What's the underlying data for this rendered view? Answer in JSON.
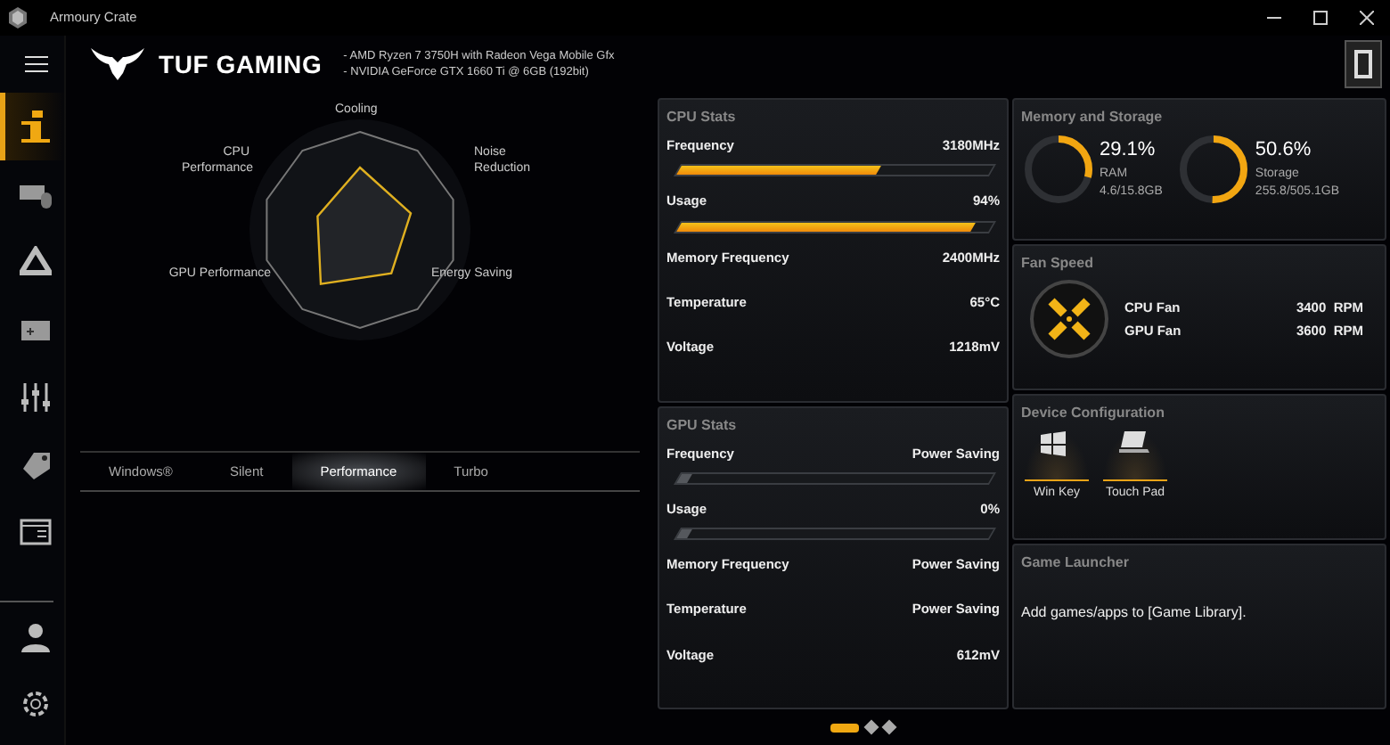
{
  "window": {
    "title": "Armoury Crate"
  },
  "header": {
    "brand": "TUF GAMING",
    "specs": [
      "-  AMD Ryzen 7 3750H with Radeon Vega Mobile Gfx",
      "-  NVIDIA GeForce GTX 1660 Ti @ 6GB (192bit)"
    ]
  },
  "sidebar": {
    "items": [
      {
        "kind": "info",
        "selected": true
      },
      {
        "kind": "keyboard",
        "selected": false
      },
      {
        "kind": "triangle",
        "selected": false
      },
      {
        "kind": "gamepad",
        "selected": false
      },
      {
        "kind": "sliders",
        "selected": false
      },
      {
        "kind": "tag",
        "selected": false
      },
      {
        "kind": "screen",
        "selected": false
      }
    ],
    "bottom": [
      {
        "kind": "user",
        "selected": false
      },
      {
        "kind": "settings",
        "selected": false
      }
    ]
  },
  "radar": {
    "axes": [
      "Cooling",
      "CPU Performance",
      "Noise Reduction",
      "GPU Performance",
      "Energy Saving"
    ]
  },
  "modes": [
    {
      "label": "Windows®",
      "selected": false
    },
    {
      "label": "Silent",
      "selected": false
    },
    {
      "label": "Performance",
      "selected": true
    },
    {
      "label": "Turbo",
      "selected": false
    }
  ],
  "cpu_stats": {
    "title": "CPU Stats",
    "rows": [
      {
        "kind": "bar",
        "label": "Frequency",
        "value": "3180MHz",
        "level": 0.64
      },
      {
        "kind": "bar",
        "label": "Usage",
        "value": "94%",
        "level": 0.94
      },
      {
        "kind": "text",
        "label": "Memory Frequency",
        "value": "2400MHz"
      },
      {
        "kind": "text",
        "label": "Temperature",
        "value": "65°C"
      },
      {
        "kind": "text",
        "label": "Voltage",
        "value": "1218mV"
      }
    ]
  },
  "gpu_stats": {
    "title": "GPU Stats",
    "rows": [
      {
        "kind": "bar",
        "label": "Frequency",
        "value": "Power Saving",
        "level": 0
      },
      {
        "kind": "bar",
        "label": "Usage",
        "value": "0%",
        "level": 0
      },
      {
        "kind": "text",
        "label": "Memory Frequency",
        "value": "Power Saving"
      },
      {
        "kind": "text",
        "label": "Temperature",
        "value": "Power Saving"
      },
      {
        "kind": "text",
        "label": "Voltage",
        "value": "612mV"
      }
    ]
  },
  "memory_storage": {
    "title": "Memory and Storage",
    "gauges": [
      {
        "percent": "29.1%",
        "label": "RAM",
        "detail": "4.6/15.8GB",
        "level": 0.291
      },
      {
        "percent": "50.6%",
        "label": "Storage",
        "detail": "255.8/505.1GB",
        "level": 0.506
      }
    ]
  },
  "fan_speed": {
    "title": "Fan Speed",
    "fans": [
      {
        "label": "CPU Fan",
        "value": "3400  RPM"
      },
      {
        "label": "GPU Fan",
        "value": "3600  RPM"
      }
    ]
  },
  "device_configuration": {
    "title": "Device Configuration",
    "items": [
      {
        "kind": "winkey",
        "label": "Win Key"
      },
      {
        "kind": "touchpad",
        "label": "Touch Pad"
      }
    ]
  },
  "game_launcher": {
    "title": "Game Launcher",
    "text": "Add games/apps to [Game Library]."
  },
  "pager": [
    {
      "selected": true
    },
    {
      "selected": false
    },
    {
      "selected": false
    }
  ]
}
